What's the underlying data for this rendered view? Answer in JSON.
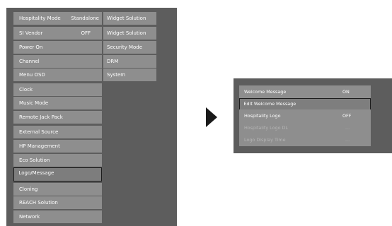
{
  "menu": {
    "col1": [
      "Hospitality Mode",
      "SI Vendor",
      "Power On",
      "Channel",
      "Menu OSD",
      "Clock",
      "Music Mode",
      "Remote Jack Pack",
      "External Source",
      "HP Management",
      "Eco Solution",
      "Logo/Message",
      "Cloning",
      "REACH Solution",
      "Network"
    ],
    "col1_values": [
      "Standalone",
      "OFF"
    ],
    "col2": [
      "Widget Solution",
      "Widget Solution",
      "Security Mode",
      "DRM",
      "System"
    ],
    "selected": "Logo/Message"
  },
  "arrow_icon": "right-triangle-arrow",
  "submenu": {
    "items": [
      {
        "label": "Welcome Message",
        "value": "ON"
      },
      {
        "label": "Edit Welcome Message",
        "value": ""
      },
      {
        "label": "Hospitality Logo",
        "value": "OFF"
      },
      {
        "label": "Hospitality Logo DL",
        "value": "..."
      },
      {
        "label": "Logo Display Time",
        "value": "..."
      }
    ],
    "selected": "Edit Welcome Message",
    "disabled": [
      "Hospitality Logo DL",
      "Logo Display Time"
    ]
  },
  "colors": {
    "panel": "#5d5d5d",
    "item": "#8e8e8e",
    "selected_border": "#1c1c1c"
  }
}
